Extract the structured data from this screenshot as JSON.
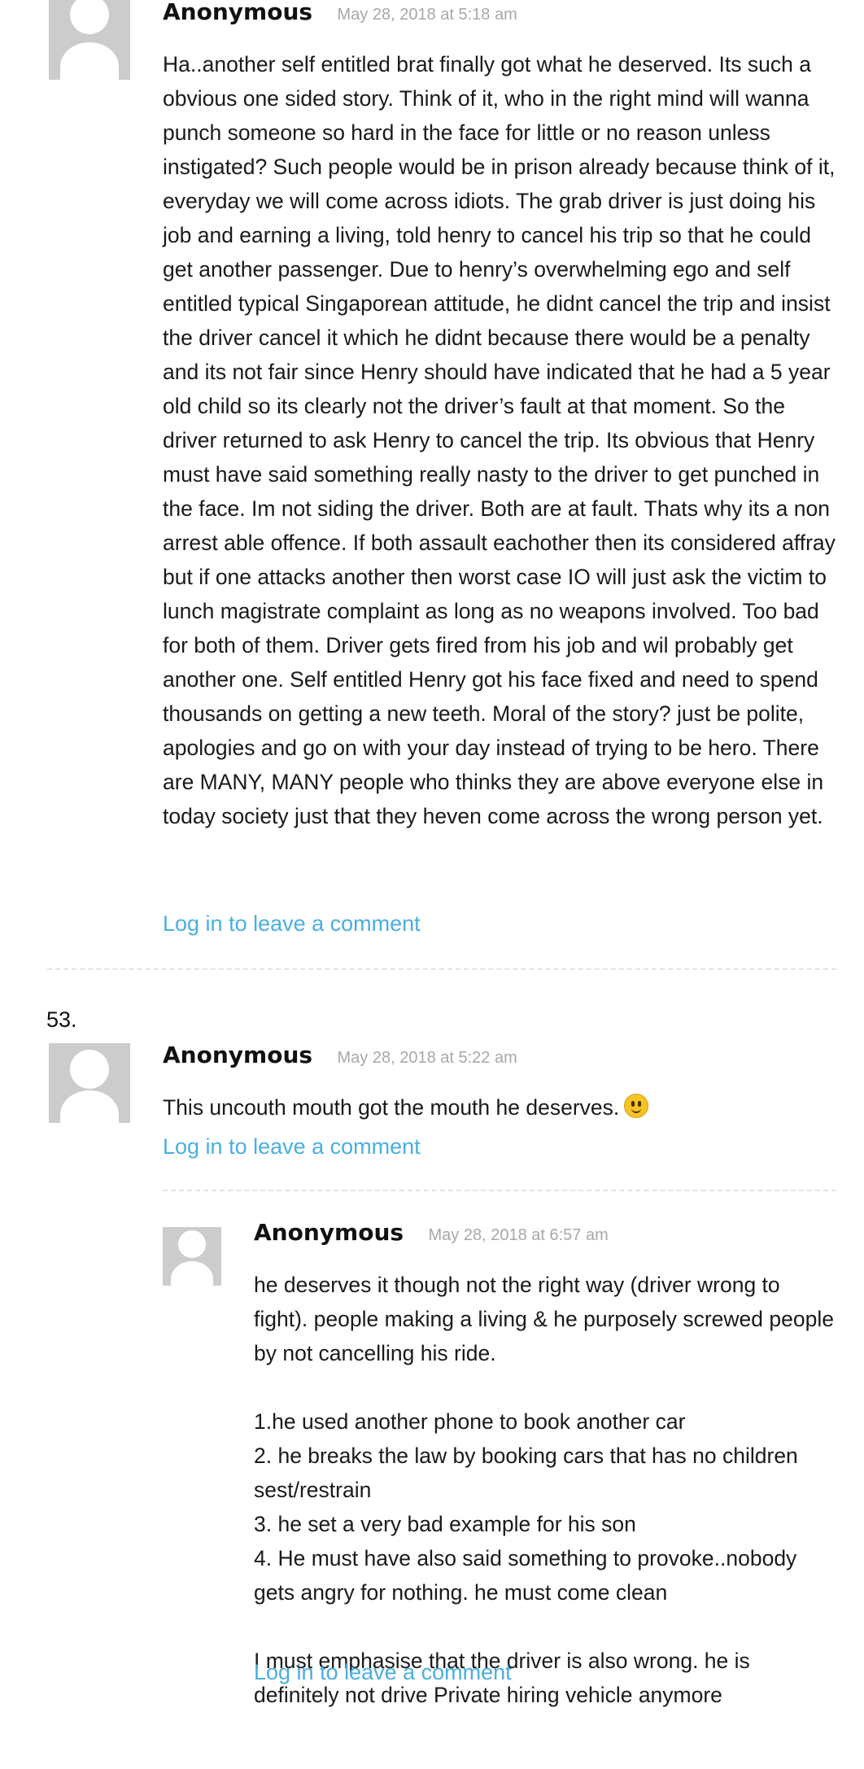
{
  "comments": [
    {
      "author": "Anonymous",
      "date": "May 28, 2018 at 5:18 am",
      "paragraphs": [
        "Ha..another self entitled brat finally got what he deserved. Its such a obvious one sided story. Think of it, who in the right mind will wanna punch someone so hard in the face for little or no reason unless instigated? Such people would be in prison already because think of it, everyday we will come across idiots. The grab driver is just doing his job and earning a living, told henry to cancel his trip so that he could get another passenger. Due to henry’s overwhelming ego and self entitled typical Singaporean attitude, he didnt cancel the trip and insist the driver cancel it which he didnt because there would be a penalty and its not fair since Henry should have indicated that he had a 5 year old child so its clearly not the driver’s fault at that moment. So the driver returned to ask Henry to cancel the trip. Its obvious that Henry must have said something really nasty to the driver to get punched in the face. Im not siding the driver. Both are at fault. Thats why its a non arrest able offence. If both assault eachother then its considered affray but if one attacks another then worst case IO will just ask the victim to lunch magistrate complaint as long as no weapons involved. Too bad for both of them. Driver gets fired from his job and wil probably get another one. Self entitled Henry got his face fixed and need to spend thousands on getting a new teeth. Moral of the story? just be polite, apologies and go on with your day instead of trying to be hero. There are MANY, MANY people who thinks they are above everyone else in today society just that they heven come across the wrong person yet."
      ],
      "login_label": "Log in to leave a comment"
    },
    {
      "number": "53.",
      "author": "Anonymous",
      "date": "May 28, 2018 at 5:22 am",
      "paragraphs": [
        "This uncouth mouth got the mouth he deserves."
      ],
      "emoji": "slightly-smiling-face",
      "login_label": "Log in to leave a comment"
    },
    {
      "author": "Anonymous",
      "date": "May 28, 2018 at 6:57 am",
      "paragraphs": [
        "he deserves it though not the right way (driver wrong to fight). people making a living & he purposely screwed people by not cancelling his ride.",
        "1.he used another phone to book another car\n2. he breaks the law by booking cars that has no children sest/restrain\n3. he set a very bad example for his son\n4. He must have also said something to provoke..nobody gets angry for nothing. he must come clean",
        "I must emphasise that the driver is also wrong. he is definitely not drive Private hiring vehicle anymore"
      ],
      "login_label": "Log in to leave a comment"
    }
  ],
  "colors": {
    "link": "#4aaee0",
    "date": "#a8a8a8",
    "avatar": "#cccccc",
    "divider": "#e3e3e3"
  }
}
